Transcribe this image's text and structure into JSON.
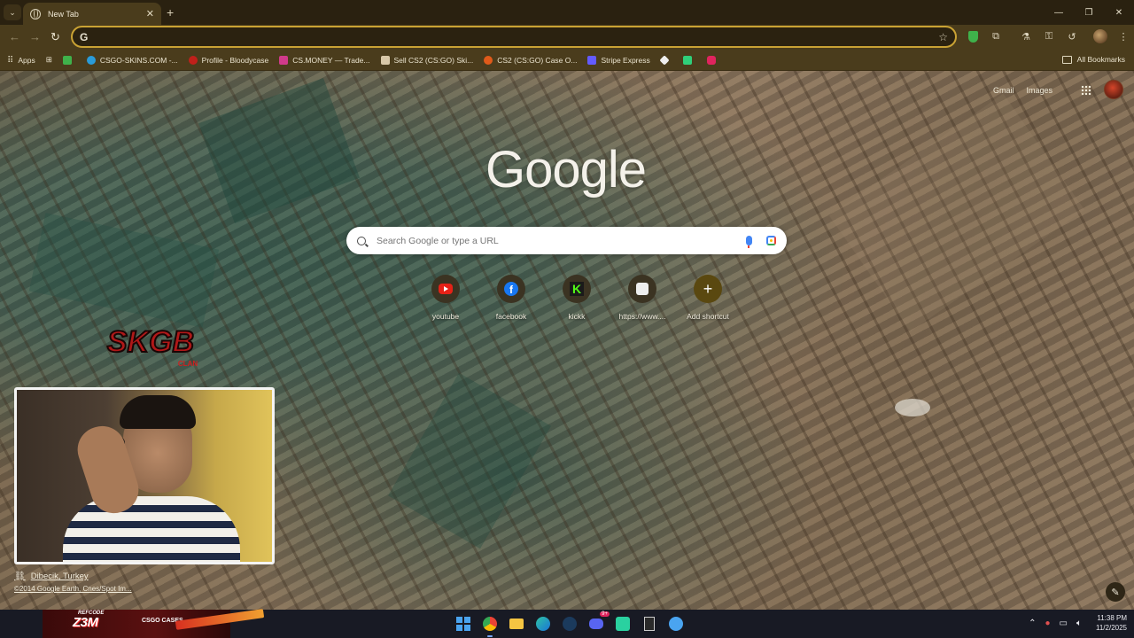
{
  "browser": {
    "tab_title": "New Tab",
    "tab_search_icon": "chevron-down-icon",
    "new_tab_symbol": "+",
    "window_controls": [
      "—",
      "❐",
      "✕"
    ],
    "omnibox": {
      "value": "",
      "prefix": "G"
    },
    "accent_color": "#c9a234"
  },
  "bookmarks": {
    "apps_label": "Apps",
    "items": [
      {
        "label": "CSGO-SKINS.COM -...",
        "color": "#2a9bd8"
      },
      {
        "label": "Profile - Bloodycase",
        "color": "#c0201a"
      },
      {
        "label": "CS.MONEY — Trade...",
        "color": "#d03a8a"
      },
      {
        "label": "Sell CS2 (CS:GO) Ski...",
        "color": "#d8c8a8"
      },
      {
        "label": "CS2 (CS:GO) Case O...",
        "color": "#e05a1a"
      },
      {
        "label": "Stripe Express",
        "color": "#635bff"
      }
    ],
    "all_bookmarks_label": "All Bookmarks"
  },
  "ntp": {
    "top_links": [
      "Gmail",
      "Images"
    ],
    "logo_text": "Google",
    "search_placeholder": "Search Google or type a URL",
    "shortcuts": [
      {
        "label": "youtube",
        "icon": "youtube-icon"
      },
      {
        "label": "facebook",
        "icon": "facebook-icon"
      },
      {
        "label": "kickk",
        "icon": "kick-icon"
      },
      {
        "label": "https://www....",
        "icon": "ghost-icon"
      },
      {
        "label": "Add shortcut",
        "icon": "plus-icon"
      }
    ],
    "background_location": "Dibecik, Turkey",
    "background_credit": "©2014 Google Earth, Cnes/Spot Im..."
  },
  "overlay": {
    "clan_logo_text": "SKGB",
    "clan_sub": "CLAN",
    "promo_code_label": "REFCODE",
    "promo_code": "Z3M",
    "promo_brand": "CSGO CASES"
  },
  "taskbar": {
    "time": "11:38 PM",
    "date": "11/2/2025",
    "discord_badge": "9+"
  }
}
